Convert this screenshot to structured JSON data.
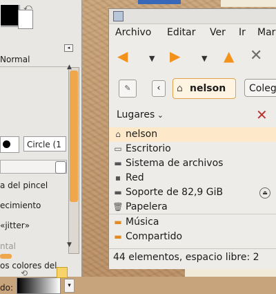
{
  "toolbox": {
    "mode": "Normal",
    "brush": "Circle (1",
    "options": [
      "a del pincel",
      "ecimiento",
      "«jitter»",
      "ntal",
      "os colores del"
    ],
    "gradient_label": "do:"
  },
  "window": {
    "menu": [
      "Archivo",
      "Editar",
      "Ver",
      "Ir",
      "Mar"
    ],
    "path_current": "nelson",
    "path_next": "Coleg",
    "places_label": "Lugares",
    "places": [
      {
        "label": "nelson",
        "icon": "home-icon"
      },
      {
        "label": "Escritorio",
        "icon": "desktop-icon"
      },
      {
        "label": "Sistema de archivos",
        "icon": "drive-icon"
      },
      {
        "label": "Red",
        "icon": "network-icon"
      },
      {
        "label": "Soporte de 82,9 GiB",
        "icon": "drive-icon"
      },
      {
        "label": "Papelera",
        "icon": "trash-icon"
      },
      {
        "label": "Música",
        "icon": "folder-icon"
      },
      {
        "label": "Compartido",
        "icon": "folder-icon"
      }
    ],
    "status": "44 elementos, espacio libre: 2"
  },
  "colors": {
    "accent": "#f0a64a",
    "selection": "#fde9c9",
    "arrow": "#f2921a"
  }
}
